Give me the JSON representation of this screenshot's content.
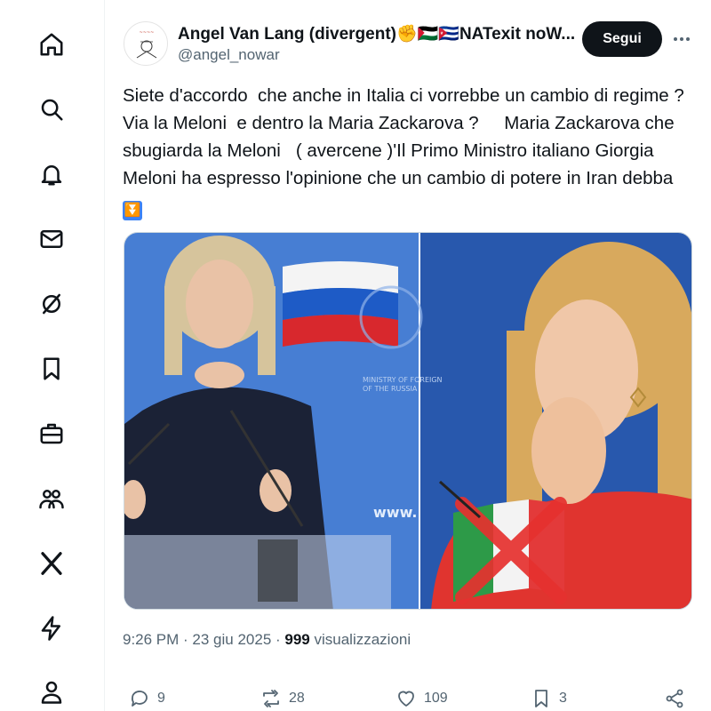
{
  "nav": {
    "items": [
      {
        "icon": "home-icon"
      },
      {
        "icon": "search-icon"
      },
      {
        "icon": "bell-icon"
      },
      {
        "icon": "mail-icon"
      },
      {
        "icon": "grok-icon"
      },
      {
        "icon": "bookmark-icon"
      },
      {
        "icon": "briefcase-icon"
      },
      {
        "icon": "communities-icon"
      },
      {
        "icon": "x-logo-icon"
      },
      {
        "icon": "bolt-icon"
      },
      {
        "icon": "profile-icon"
      }
    ]
  },
  "post": {
    "author_name": "Angel Van Lang (divergent)✊🇵🇸🇨🇺NATexit noW...",
    "author_handle": "@angel_nowar",
    "follow_label": "Segui",
    "text": "Siete d'accordo  che anche in Italia ci vorrebbe un cambio di regime ? Via la Meloni  e dentro la Maria Zackarova ?     Maria Zackarova che sbugiarda la Meloni   ( avercene )'Il Primo Ministro italiano Giorgia Meloni ha espresso l'opinione che un cambio di potere in Iran debba",
    "text_end_emoji": "⏬",
    "time": "9:26 PM · 23 giu 2025 · ",
    "views_count": "999",
    "views_label": " visualizzazioni",
    "media_caption_fragment": "www."
  },
  "actions": {
    "replies": "9",
    "reposts": "28",
    "likes": "109",
    "bookmarks": "3"
  },
  "colors": {
    "accent": "#0f1419",
    "muted": "#536471",
    "image_left_bg": "#3a6fc4",
    "image_right_bg": "#1f4fa6"
  }
}
